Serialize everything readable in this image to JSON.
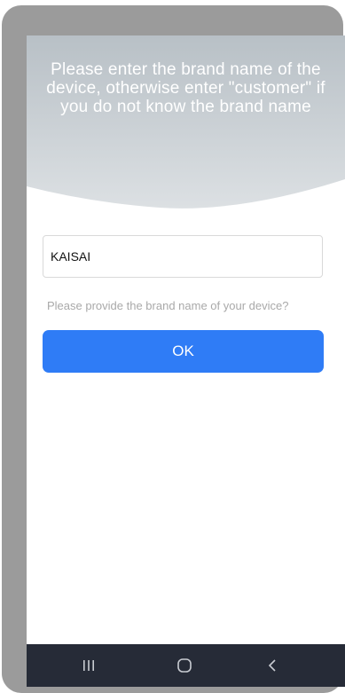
{
  "header": {
    "message": "Please enter the brand name of the device, otherwise enter \"customer\" if you do not know the brand name"
  },
  "form": {
    "brand_value": "KAISAI",
    "hint": "Please provide the brand name of your device?",
    "ok_label": "OK"
  },
  "navbar": {
    "recents_icon": "recent-apps-icon",
    "home_icon": "home-icon",
    "back_icon": "back-icon"
  },
  "colors": {
    "header_gradient_top": "#c3cad0",
    "header_gradient_bottom": "#d9dde1",
    "button": "#2f7cf6",
    "navbar": "#262b37",
    "frame": "#9b9b9b"
  }
}
